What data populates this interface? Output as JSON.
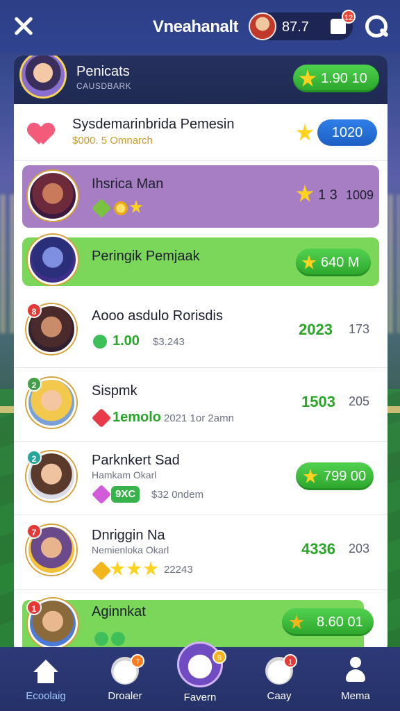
{
  "topbar": {
    "title": "Vneahanalt",
    "coins": "87.7",
    "notification_count": "12"
  },
  "header": {
    "name": "Penicats",
    "subtitle": "CAUSDBARK",
    "score": "1.90 10"
  },
  "rows": [
    {
      "title": "Sysdemarinbrida Pemesin",
      "subtitle": "$000. 5 Omnarch",
      "score": "1020"
    },
    {
      "title": "Ihsrica Man",
      "score": "1 3",
      "secondary": "1009"
    },
    {
      "title": "Peringik Pemjaak",
      "score": "640 M"
    },
    {
      "rank": "8",
      "title": "Aooo asdulo Rorisdis",
      "stat": "1.00",
      "sub": "$3.243",
      "score": "2023",
      "secondary": "173"
    },
    {
      "rank": "2",
      "title": "Sispmk",
      "stat": "1emolo",
      "sub": "2021 1or 2amn",
      "score": "1503",
      "secondary": "205"
    },
    {
      "rank": "2",
      "title": "Parknkert Sad",
      "subtitle": "Hamkam Okarl",
      "tag": "9XC",
      "sub": "$32 0ndem",
      "score": "799 00"
    },
    {
      "rank": "7",
      "title": "Dnriggin Na",
      "subtitle": "Nemienloka Okarl",
      "sub": "22243",
      "score": "4336",
      "secondary": "203"
    },
    {
      "rank": "1",
      "title": "Aginnkat",
      "score": "8.60 01"
    }
  ],
  "nav": {
    "items": [
      {
        "label": "Ecoolaig",
        "badge": ""
      },
      {
        "label": "Droaler",
        "badge": "7"
      },
      {
        "label": "Favern",
        "badge": "9"
      },
      {
        "label": "Caay",
        "badge": "1"
      },
      {
        "label": "Mema",
        "badge": ""
      }
    ]
  },
  "colors": {
    "accent_green": "#2aa52a",
    "accent_blue": "#1d5fc4",
    "purple_row": "#a77ec4",
    "green_row": "#7ad75a",
    "nav_bg": "#253168"
  },
  "icons": [
    "close-icon",
    "search-icon",
    "bell-icon",
    "star-icon",
    "heart-icon",
    "home-icon",
    "pet-icon",
    "person-icon"
  ]
}
